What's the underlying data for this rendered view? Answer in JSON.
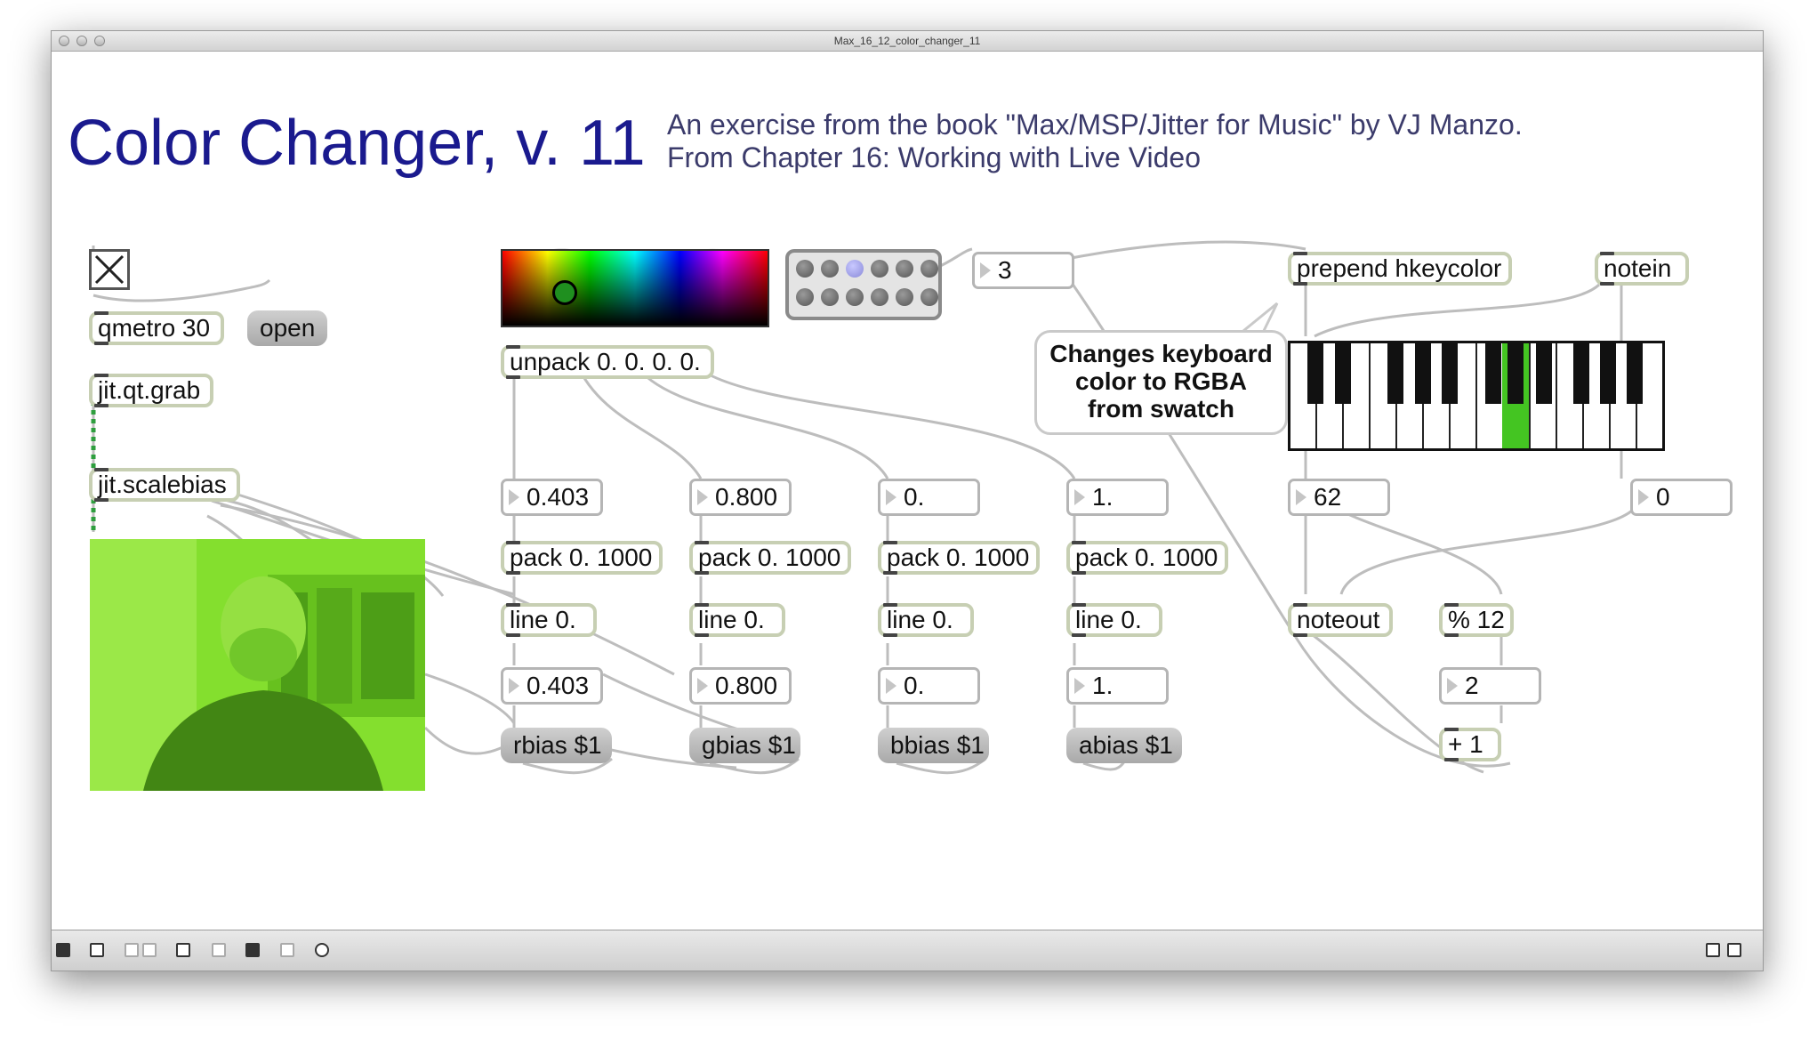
{
  "window": {
    "title": "Max_16_12_color_changer_11"
  },
  "header": {
    "title": "Color Changer, v. 11",
    "subtitle_line1": "An exercise from the book \"Max/MSP/Jitter for Music\" by VJ Manzo.",
    "subtitle_line2": "From Chapter 16: Working with Live Video"
  },
  "objects": {
    "qmetro": "qmetro 30",
    "open_msg": "open",
    "grab": "jit.qt.grab",
    "scalebias": "jit.scalebias",
    "unpack": "unpack 0. 0. 0. 0.",
    "pack_r": "pack 0. 1000",
    "pack_g": "pack 0. 1000",
    "pack_b": "pack 0. 1000",
    "pack_a": "pack 0. 1000",
    "line_r": "line 0.",
    "line_g": "line 0.",
    "line_b": "line 0.",
    "line_a": "line 0.",
    "rbias": "rbias $1",
    "gbias": "gbias $1",
    "bbias": "bbias $1",
    "abias": "abias $1",
    "prepend": "prepend hkeycolor",
    "notein": "notein",
    "noteout": "noteout",
    "mod": "% 12",
    "plus": "+ 1"
  },
  "numbers": {
    "matrix_sel": "3",
    "r_in": "0.403",
    "g_in": "0.800",
    "b_in": "0.",
    "a_in": "1.",
    "r_out": "0.403",
    "g_out": "0.800",
    "b_out": "0.",
    "a_out": "1.",
    "pitch": "62",
    "velocity": "0",
    "mod_result": "2"
  },
  "comment": {
    "line1": "Changes keyboard",
    "line2": "color to RGBA",
    "line3": "from swatch"
  },
  "keyboard": {
    "highlighted_black_key_index": 5,
    "highlight_color": "#44c522"
  },
  "colors": {
    "title": "#1a1a8e",
    "object_border": "#c7cfb3",
    "video_tint": "#7fdc2a"
  },
  "status_icons": [
    "lock-icon",
    "edit-icon",
    "presentation-icon",
    "close-icon",
    "inspector-icon",
    "info-icon",
    "patcher-icon",
    "grid-icon",
    "debug-icon",
    "split-left-icon",
    "split-right-icon"
  ]
}
